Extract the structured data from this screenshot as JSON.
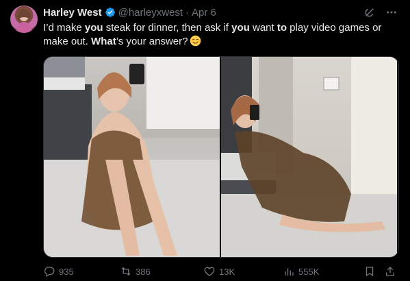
{
  "author": {
    "display_name": "Harley West",
    "handle": "@harleyxwest",
    "separator": "·",
    "date": "Apr 6",
    "verified": true,
    "verified_color": "#1d9bf0"
  },
  "tweet": {
    "segments": [
      {
        "text": "I’d make ",
        "bold": false
      },
      {
        "text": "you",
        "bold": true
      },
      {
        "text": " steak for dinner, then ask if ",
        "bold": false
      },
      {
        "text": "you",
        "bold": true
      },
      {
        "text": " want ",
        "bold": false
      },
      {
        "text": "to",
        "bold": true
      },
      {
        "text": " play video games or make out. ",
        "bold": false
      },
      {
        "text": "What",
        "bold": true
      },
      {
        "text": "’s your answer?",
        "bold": false
      }
    ],
    "emoji": "smiling-face-emoji"
  },
  "media": {
    "photos": [
      {
        "alt_icon": "photo-woman-seated-on-floor"
      },
      {
        "alt_icon": "photo-woman-kneeling-by-bed"
      }
    ]
  },
  "actions": {
    "replies": "935",
    "reposts": "386",
    "likes": "13K",
    "views": "555K"
  },
  "icons": {
    "grok": "grok-icon",
    "more": "more-icon",
    "reply": "reply-icon",
    "repost": "repost-icon",
    "like": "heart-icon",
    "views": "views-icon",
    "bookmark": "bookmark-icon",
    "share": "share-icon"
  },
  "colors": {
    "background": "#000000",
    "text": "#e7e9ea",
    "muted": "#71767b",
    "border": "#2f3336"
  }
}
